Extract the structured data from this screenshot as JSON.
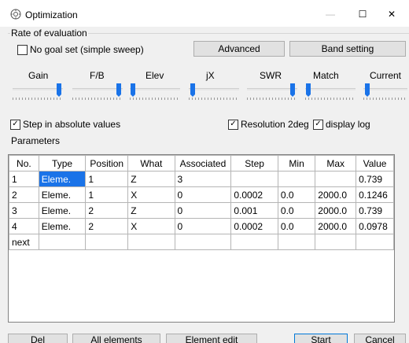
{
  "window": {
    "title": "Optimization",
    "min_glyph": "—",
    "max_glyph": "☐",
    "close_glyph": "✕"
  },
  "evaluation": {
    "group_label": "Rate of evaluation",
    "no_goal_label": "No goal set (simple sweep)",
    "no_goal_checked": false,
    "advanced_button": "Advanced",
    "band_setting_button": "Band setting"
  },
  "sliders": [
    {
      "label": "Gain"
    },
    {
      "label": "F/B"
    },
    {
      "label": "Elev"
    },
    {
      "label": "jX"
    },
    {
      "label": "SWR"
    },
    {
      "label": "Match"
    },
    {
      "label": "Current"
    }
  ],
  "options": {
    "absolute_label": "Step in absolute values",
    "absolute_checked": true,
    "resolution_label": "Resolution 2deg",
    "resolution_checked": true,
    "log_label": "display log",
    "log_checked": true,
    "check_glyph": "✓"
  },
  "parameters": {
    "section_label": "Parameters",
    "columns": [
      "No.",
      "Type",
      "Position",
      "What",
      "Associated",
      "Step",
      "Min",
      "Max",
      "Value"
    ],
    "rows": [
      [
        "1",
        "Eleme.",
        "1",
        "Z",
        "3",
        "",
        "",
        "",
        "0.739"
      ],
      [
        "2",
        "Eleme.",
        "1",
        "X",
        "0",
        "0.0002",
        "0.0",
        "2000.0",
        "0.1246"
      ],
      [
        "3",
        "Eleme.",
        "2",
        "Z",
        "0",
        "0.001",
        "0.0",
        "2000.0",
        "0.739"
      ],
      [
        "4",
        "Eleme.",
        "2",
        "X",
        "0",
        "0.0002",
        "0.0",
        "2000.0",
        "0.0978"
      ],
      [
        "next",
        "",
        "",
        "",
        "",
        "",
        "",
        "",
        ""
      ]
    ]
  },
  "buttons": {
    "del": "Del",
    "all_elements": "All elements",
    "element_edit": "Element edit",
    "start": "Start",
    "cancel": "Cancel"
  }
}
